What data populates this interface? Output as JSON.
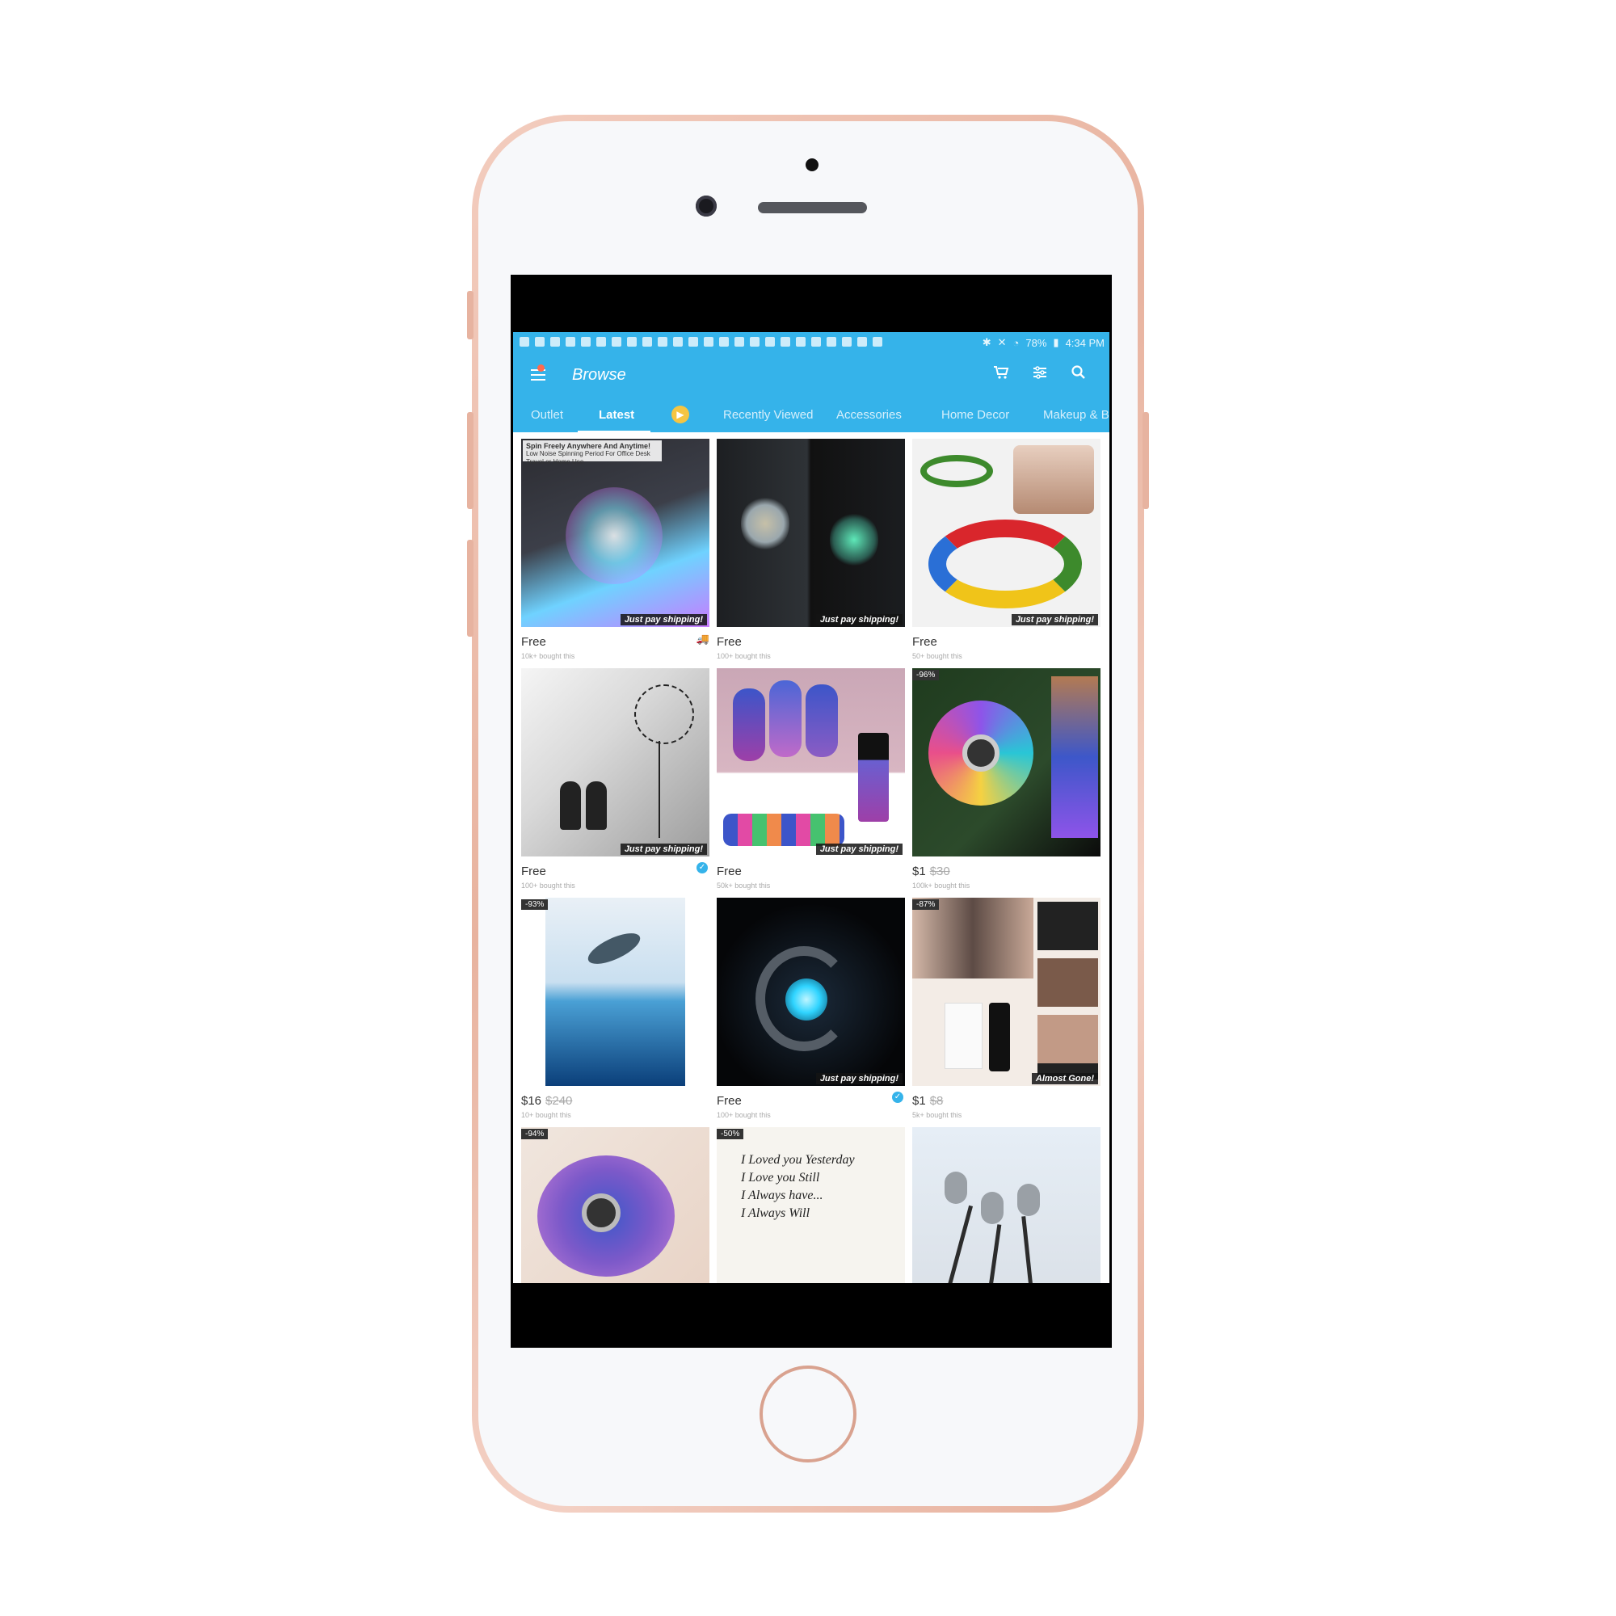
{
  "status": {
    "battery": "78%",
    "time": "4:34 PM"
  },
  "appbar": {
    "title": "Browse",
    "icons": [
      "menu-icon",
      "cart-icon",
      "filter-icon",
      "search-icon"
    ]
  },
  "tabs": [
    "Outlet",
    "Latest",
    "Recently Viewed",
    "Accessories",
    "Home Decor",
    "Makeup & Be"
  ],
  "active_tab": "Latest",
  "products": [
    {
      "caption_title": "Spin Freely Anywhere And Anytime!",
      "caption_sub": "Low Noise Spinning Period For Office Desk Travel or Home Use",
      "tag": "Just pay shipping!",
      "price": "Free",
      "sold": "10k+ bought this",
      "colors": [
        "#2b2b30",
        "#6fd2ff",
        "#c87bff"
      ]
    },
    {
      "tag": "Just pay shipping!",
      "price": "Free",
      "sold": "100+ bought this",
      "colors": [
        "#1d1f22",
        "#9aa7ad",
        "#5ee8b8"
      ]
    },
    {
      "tag": "Just pay shipping!",
      "price": "Free",
      "sold": "50+ bought this",
      "colors": [
        "#f2f2f2",
        "#3d8a2c",
        "#d9262c"
      ]
    },
    {
      "tag": "Just pay shipping!",
      "price": "Free",
      "sold": "100+ bought this",
      "colors": [
        "#d9d9d9",
        "#9c9c9c",
        "#222"
      ]
    },
    {
      "tag": "Just pay shipping!",
      "price": "Free",
      "sold": "50k+ bought this",
      "colors": [
        "#caa7b6",
        "#3c55c9",
        "#9e3fa8"
      ]
    },
    {
      "discount": "-96%",
      "price": "$1",
      "was": "$30",
      "sold": "100k+ bought this",
      "colors": [
        "#1f3b1e",
        "#8e54e9",
        "#29c6d6"
      ]
    },
    {
      "discount": "-93%",
      "price": "$16",
      "was": "$240",
      "sold": "10+ bought this",
      "colors": [
        "#e9f0f6",
        "#4aa0d5",
        "#0b3f7a"
      ]
    },
    {
      "tag": "Just pay shipping!",
      "price": "Free",
      "sold": "100+ bought this",
      "colors": [
        "#050608",
        "#1b2a3a",
        "#2fd4ff"
      ]
    },
    {
      "discount": "-87%",
      "tag": "Almost Gone!",
      "price": "$1",
      "was": "$8",
      "sold": "5k+ bought this",
      "colors": [
        "#f3ece6",
        "#5d4b45",
        "#222"
      ]
    },
    {
      "discount": "-94%",
      "colors": [
        "#f0e6de",
        "#7c59c9",
        "#3d57c9"
      ]
    },
    {
      "discount": "-50%",
      "lines": [
        "I Loved you Yesterday",
        "I Love you Still",
        "I Always have...",
        "I Always Will"
      ],
      "colors": [
        "#f6f4ef",
        "#222",
        "#d22a2a"
      ]
    },
    {
      "colors": [
        "#e6eef6",
        "#9aa0a6",
        "#2c2c2c"
      ]
    }
  ],
  "accent": "#35b3ea"
}
